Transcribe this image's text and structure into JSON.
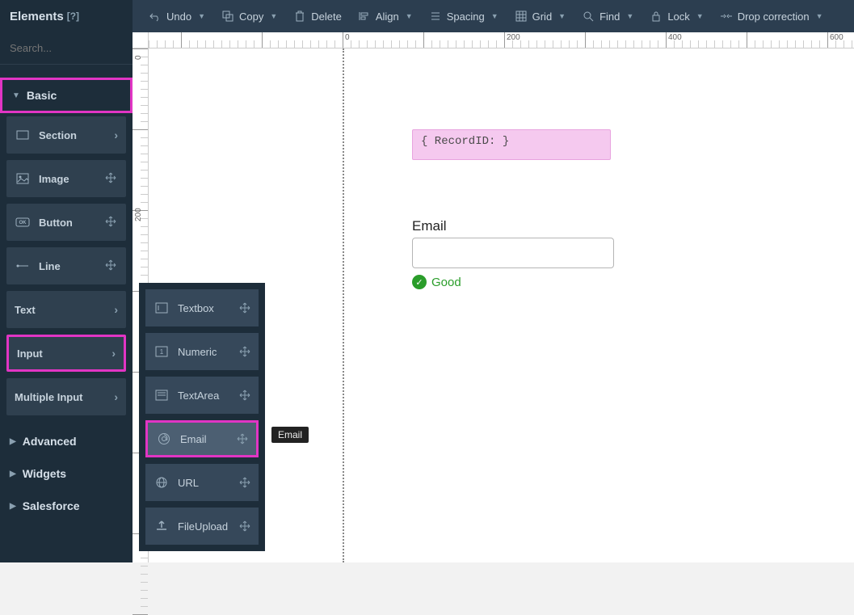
{
  "sidebar": {
    "title": "Elements",
    "help": "[?]",
    "search_placeholder": "Search...",
    "categories": {
      "basic": "Basic",
      "advanced": "Advanced",
      "widgets": "Widgets",
      "salesforce": "Salesforce"
    },
    "basic_items": {
      "section": "Section",
      "image": "Image",
      "button": "Button",
      "line": "Line",
      "text": "Text",
      "input": "Input",
      "multiple_input": "Multiple Input"
    }
  },
  "input_submenu": {
    "textbox": "Textbox",
    "numeric": "Numeric",
    "textarea": "TextArea",
    "email": "Email",
    "url": "URL",
    "fileupload": "FileUpload"
  },
  "tooltip": "Email",
  "toolbar": {
    "undo": "Undo",
    "copy": "Copy",
    "delete": "Delete",
    "align": "Align",
    "spacing": "Spacing",
    "grid": "Grid",
    "find": "Find",
    "lock": "Lock",
    "drop_correction": "Drop correction"
  },
  "ruler": {
    "h": [
      "0",
      "200",
      "400",
      "600"
    ],
    "v": [
      "0",
      "200"
    ]
  },
  "canvas": {
    "record_box": "{ RecordID: }",
    "email_label": "Email",
    "email_value": "",
    "status_text": "Good"
  }
}
